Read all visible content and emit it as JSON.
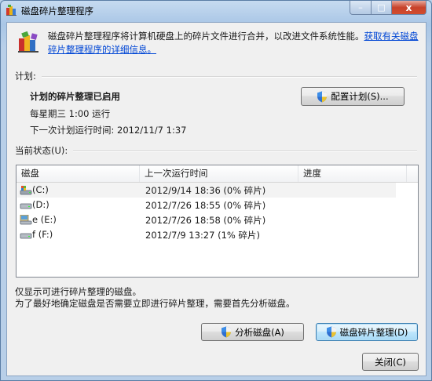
{
  "window": {
    "title": "磁盘碎片整理程序",
    "caption_min": "–",
    "caption_max": "□",
    "caption_close": "x"
  },
  "intro": {
    "text": "磁盘碎片整理程序将计算机硬盘上的碎片文件进行合并，以改进文件系统性能。",
    "link": "获取有关磁盘碎片整理程序的详细信息。"
  },
  "schedule": {
    "label": "计划:",
    "status": "计划的碎片整理已启用",
    "frequency": "每星期三 1:00 运行",
    "next_run": "下一次计划运行时间: 2012/11/7 1:37",
    "configure_button": "配置计划(S)..."
  },
  "current_status": {
    "label": "当前状态(U):",
    "columns": [
      "磁盘",
      "上一次运行时间",
      "进度"
    ],
    "rows": [
      {
        "icon": "system-drive-icon",
        "disk": "(C:)",
        "last_run": "2012/9/14 18:36 (0% 碎片)",
        "progress": ""
      },
      {
        "icon": "hard-drive-icon",
        "disk": "(D:)",
        "last_run": "2012/7/26 18:55 (0% 碎片)",
        "progress": ""
      },
      {
        "icon": "media-drive-icon",
        "disk": "e (E:)",
        "last_run": "2012/7/26 18:58 (0% 碎片)",
        "progress": ""
      },
      {
        "icon": "hard-drive-icon",
        "disk": "f (F:)",
        "last_run": "2012/7/9 13:27 (1% 碎片)",
        "progress": ""
      }
    ]
  },
  "notes": {
    "line1": "仅显示可进行碎片整理的磁盘。",
    "line2": "为了最好地确定磁盘是否需要立即进行碎片整理，需要首先分析磁盘。"
  },
  "buttons": {
    "analyze": "分析磁盘(A)",
    "defrag": "磁盘碎片整理(D)",
    "close": "关闭(C)"
  },
  "colors": {
    "link": "#0046d5",
    "title_bar": "#b9d1ea",
    "default_button": "#3c7fb1"
  }
}
